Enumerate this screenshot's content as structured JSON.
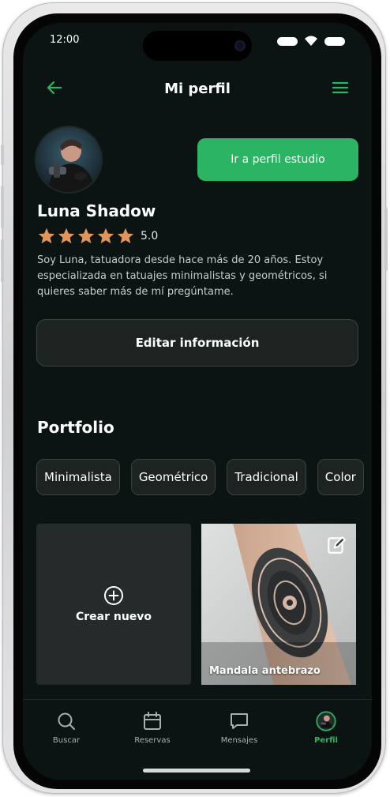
{
  "status_bar": {
    "time": "12:00"
  },
  "header": {
    "title": "Mi perfil"
  },
  "profile": {
    "studio_button": "Ir a perfil estudio",
    "name": "Luna Shadow",
    "rating_value": "5.0",
    "star_count": 5,
    "bio": "Soy Luna, tatuadora desde hace más de 20 años. Estoy especializada en tatuajes minimalistas y geométricos, si quieres saber más de mí pregúntame.",
    "edit_button": "Editar información"
  },
  "portfolio": {
    "title": "Portfolio",
    "tags": [
      "Minimalista",
      "Geométrico",
      "Tradicional",
      "Color"
    ],
    "new_card_label": "Crear nuevo",
    "items": [
      {
        "caption": "Mandala antebrazo"
      }
    ]
  },
  "tab_bar": {
    "items": [
      {
        "label": "Buscar",
        "icon": "search-icon"
      },
      {
        "label": "Reservas",
        "icon": "calendar-icon"
      },
      {
        "label": "Mensajes",
        "icon": "message-icon"
      },
      {
        "label": "Perfil",
        "icon": "avatar-icon",
        "active": true
      }
    ]
  },
  "colors": {
    "accent": "#2bb562",
    "background": "#0b1412",
    "star": "#e0955a"
  }
}
